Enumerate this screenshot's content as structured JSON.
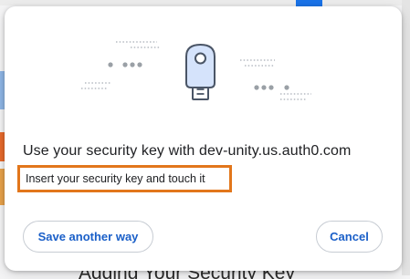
{
  "dialog": {
    "title": "Use your security key with dev-unity.us.auth0.com",
    "instruction": "Insert your security key and touch it",
    "buttons": {
      "save_another_way": "Save another way",
      "cancel": "Cancel"
    }
  },
  "background_page": {
    "heading_fragment": "Adding Your Security Key"
  },
  "colors": {
    "accent": "#1a5fc8",
    "highlight_border": "#e2761b",
    "key_body": "#d5e3fb",
    "key_outline": "#4a5566"
  },
  "icons": {
    "illustration": "security-key-icon"
  }
}
